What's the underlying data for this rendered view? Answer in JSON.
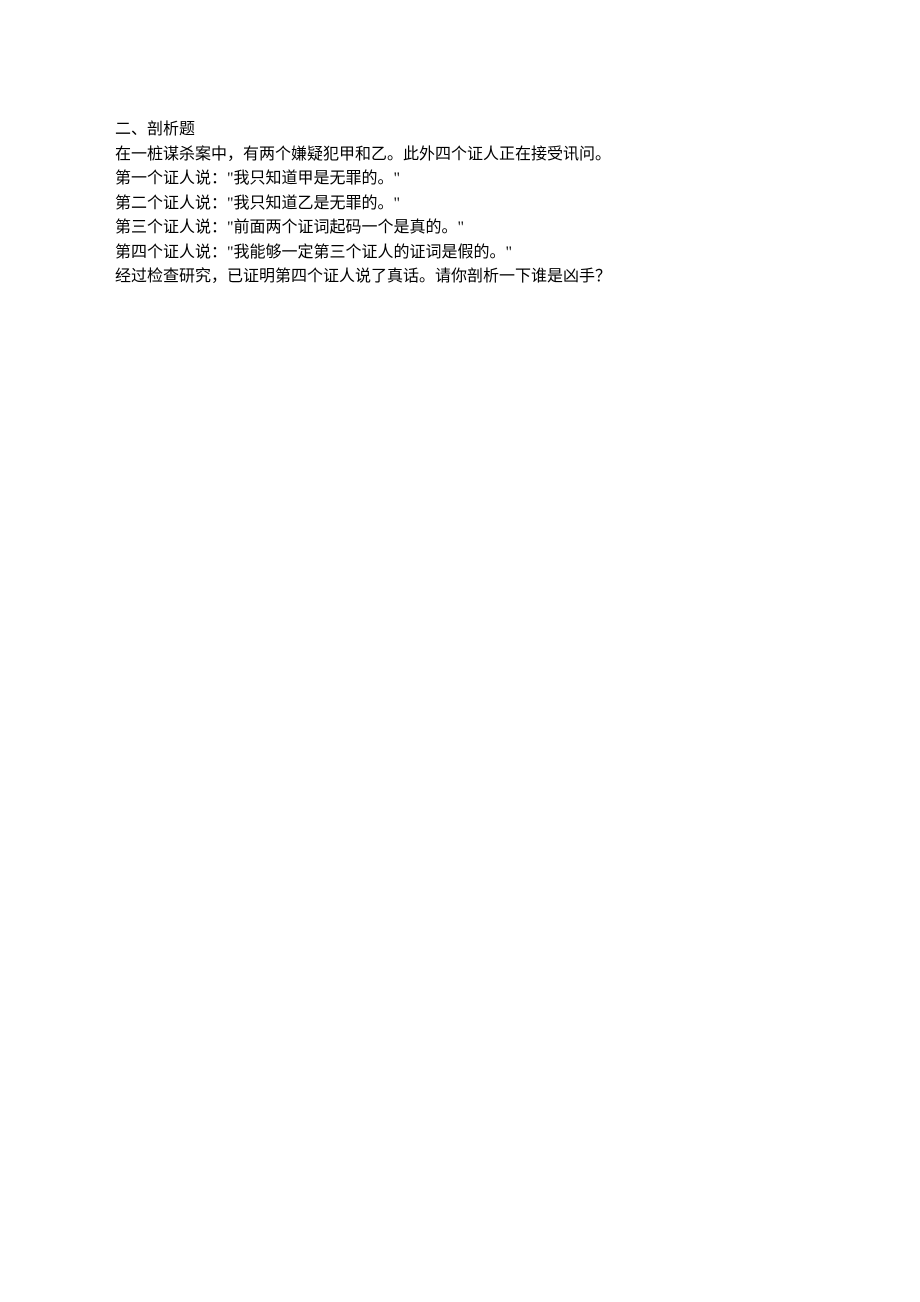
{
  "document": {
    "lines": [
      "二、剖析题",
      "在一桩谋杀案中，有两个嫌疑犯甲和乙。此外四个证人正在接受讯问。",
      "第一个证人说：\"我只知道甲是无罪的。\"",
      "第二个证人说：\"我只知道乙是无罪的。\"",
      "第三个证人说：\"前面两个证词起码一个是真的。\"",
      "第四个证人说：\"我能够一定第三个证人的证词是假的。\"",
      "经过检查研究，已证明第四个证人说了真话。请你剖析一下谁是凶手？"
    ]
  }
}
